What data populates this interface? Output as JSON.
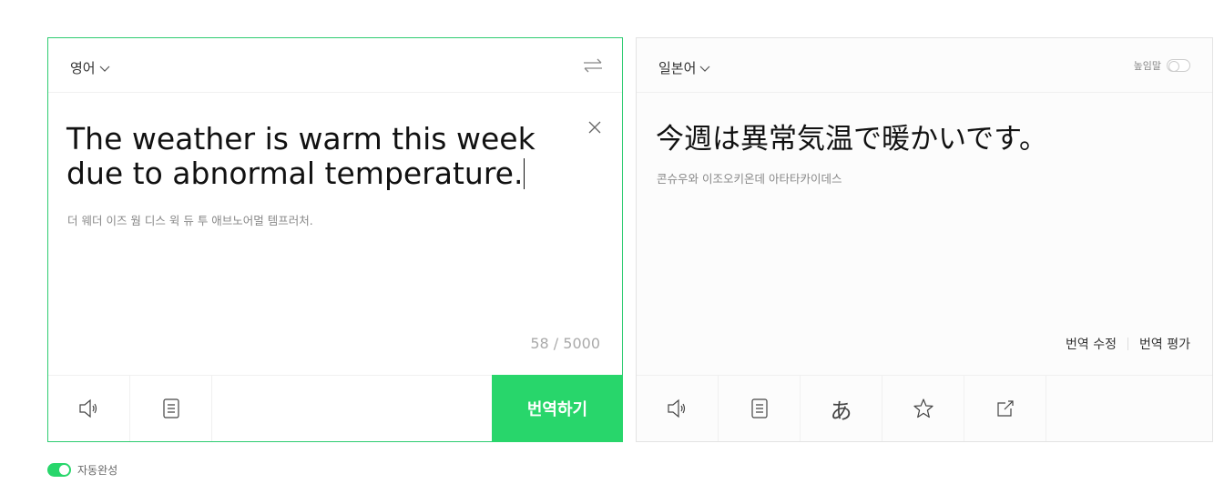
{
  "source": {
    "language": "영어",
    "text": "The weather is warm this week due to abnormal temperature.",
    "pronunciation": "더 웨더 이즈 웜 디스 윅 듀 투 애브노어멀 템프러처.",
    "char_count": "58 / 5000",
    "translate_button": "번역하기",
    "toolbar_icons": [
      "speaker-icon",
      "dictionary-icon"
    ]
  },
  "target": {
    "language": "일본어",
    "honorific_label": "높임말",
    "honorific_on": false,
    "text": "今週は異常気温で暖かいです。",
    "pronunciation": "콘슈우와 이조오키온데 아타타카이데스",
    "edit_link": "번역 수정",
    "rate_link": "번역 평가",
    "furigana_glyph": "あ",
    "toolbar_icons": [
      "speaker-icon",
      "copy-icon",
      "furigana-icon",
      "star-icon",
      "share-icon"
    ]
  },
  "footer": {
    "autocomplete_label": "자동완성",
    "autocomplete_on": true
  },
  "colors": {
    "accent": "#28d66b",
    "border_active": "#2ecc71"
  }
}
